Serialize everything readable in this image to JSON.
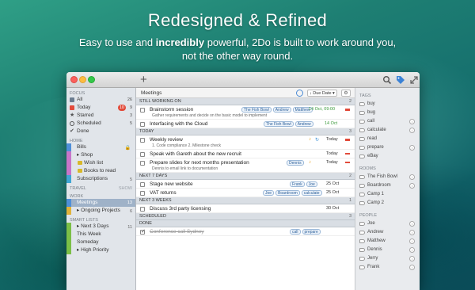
{
  "hero": {
    "title": "Redesigned & Refined",
    "sub_pre": "Easy to use and ",
    "sub_bold": "incredibly",
    "sub_post": " powerful, 2Do is built to work around you,",
    "sub_line2": "not the other way round."
  },
  "colors": {
    "accent": "#4a8ad4",
    "red_badge": "#e24b3b",
    "green_date": "#3a9a3a"
  },
  "sidebar": {
    "focus_head": "FOCUS",
    "focus": [
      {
        "label": "All",
        "count": "26",
        "icon": "inbox-icon",
        "color": "#6b7c90"
      },
      {
        "label": "Today",
        "count": "9",
        "badge": "10",
        "icon": "calendar-icon",
        "color": "#e34b3b"
      },
      {
        "label": "Starred",
        "count": "3",
        "icon": "star-icon",
        "color": "#555555"
      },
      {
        "label": "Scheduled",
        "count": "5",
        "icon": "clock-icon",
        "color": "#555555"
      },
      {
        "label": "Done",
        "count": "",
        "icon": "check-icon",
        "color": "#555555"
      }
    ],
    "home_head": "HOME",
    "home": [
      {
        "label": "Bills",
        "color": "#4f8fd8",
        "lock": "🔒",
        "indent": 0
      },
      {
        "label": "▸ Shop",
        "color": "#c775c9",
        "indent": 0
      },
      {
        "label": "Wish list",
        "color": "#c775c9",
        "indent": 1
      },
      {
        "label": "Books to read",
        "color": "#c775c9",
        "indent": 1
      },
      {
        "label": "Subscriptions",
        "count": "5",
        "color": "#3fa6d4",
        "indent": 0
      }
    ],
    "travel_head": "TRAVEL",
    "travel_show": "Show",
    "work_head": "WORK",
    "work": [
      {
        "label": "Meetings",
        "count": "13",
        "selected": true,
        "color": "#4f8fd8"
      },
      {
        "label": "▸ Ongoing Projects",
        "count": "6",
        "color": "#e0b23a"
      }
    ],
    "smart_head": "SMART LISTS",
    "smart": [
      {
        "label": "▸ Next 3 Days",
        "count": "11",
        "color": "#7bbf46"
      },
      {
        "label": "This Week",
        "count": "",
        "color": "#7bbf46"
      },
      {
        "label": "Someday",
        "count": "",
        "color": "#7bbf46"
      },
      {
        "label": "▸ High Priority",
        "count": "",
        "color": "#7bbf46"
      }
    ]
  },
  "toolbar": {
    "add": "+"
  },
  "list": {
    "title": "Meetings",
    "sort": "↓ Due Date ▾",
    "gear": "⚙ ▾",
    "sections": [
      {
        "name": "STILL WORKING ON",
        "count": "2"
      },
      {
        "name": "TODAY",
        "count": "3"
      },
      {
        "name": "NEXT 7 DAYS",
        "count": "2"
      },
      {
        "name": "NEXT 3 WEEKS",
        "count": "1"
      },
      {
        "name": "SCHEDULED",
        "count": "3"
      },
      {
        "name": "DONE",
        "count": ""
      }
    ],
    "tasks": {
      "brainstorm": {
        "title": "Brainstorm session",
        "note": "Gather requirements and decide on the basic model to implement",
        "tags": [
          "The Fish Bowl",
          "Andrew",
          "Matthew"
        ],
        "date": "14 Oct, 09:00"
      },
      "interface": {
        "title": "Interfacing with the Cloud",
        "tags": [
          "The Fish Bowl",
          "Andrew"
        ],
        "date": "14 Oct"
      },
      "weekly": {
        "title": "Weekly review",
        "note": "1. Code compliance 2. Milestone check",
        "date": "Today"
      },
      "gareth": {
        "title": "Speak with Gareth about the new recruit",
        "date": "Today"
      },
      "slides": {
        "title": "Prepare slides for next months presentation",
        "note": "Dennis to email link to documentation",
        "tags": [
          "Dennis"
        ],
        "date": "Today"
      },
      "stage": {
        "title": "Stage new website",
        "tags": [
          "Frank",
          "Joe"
        ],
        "date": "25 Oct"
      },
      "vat": {
        "title": "VAT returns",
        "tags": [
          "Joe",
          "Boardroom",
          "calculate"
        ],
        "date": "25 Oct"
      },
      "licensing": {
        "title": "Discuss 3rd party licensing",
        "date": "30 Oct"
      },
      "conference": {
        "title": "Conference call Sydney",
        "tags": [
          "call",
          "prepare"
        ]
      }
    }
  },
  "right": {
    "tags_head": "TAGS",
    "tags": [
      "buy",
      "bug",
      "call",
      "calculate",
      "read",
      "prepare",
      "eBay"
    ],
    "rooms_head": "ROOMS",
    "rooms": [
      "The Fish Bowl",
      "Boardroom",
      "Camp 1",
      "Camp 2"
    ],
    "people_head": "PEOPLE",
    "people": [
      "Joe",
      "Andrew",
      "Matthew",
      "Dennis",
      "Jerry",
      "Frank"
    ]
  }
}
